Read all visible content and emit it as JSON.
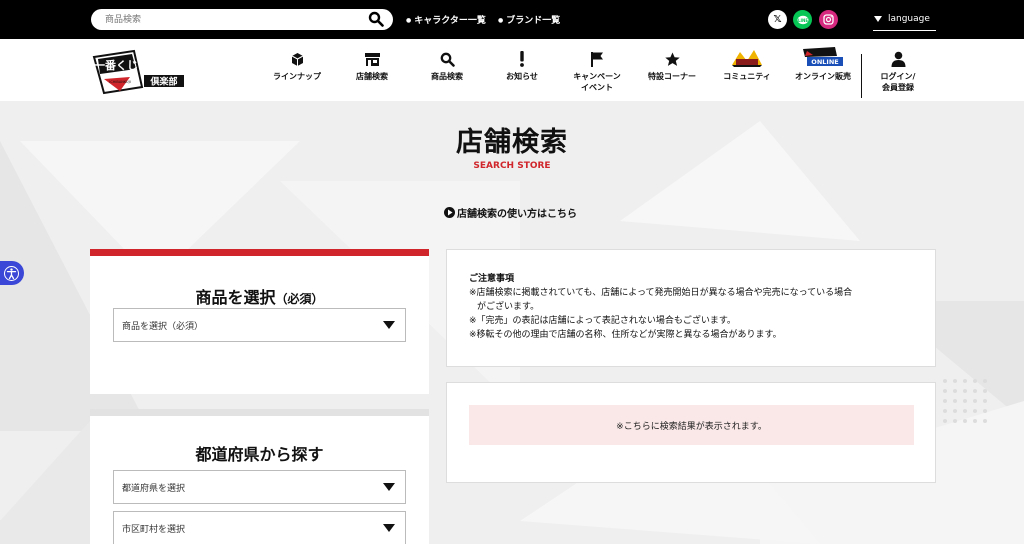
{
  "topbar": {
    "search": {
      "placeholder": "商品検索",
      "value": ""
    },
    "links": [
      "キャラクター一覧",
      "ブランド一覧"
    ],
    "social": [
      "x-icon",
      "line-icon",
      "instagram-icon"
    ],
    "language_label": "language"
  },
  "nav": {
    "logo_icon": "ichiban-kuji-club-logo",
    "items": [
      {
        "label": "ラインナップ",
        "icon": "box-icon"
      },
      {
        "label": "店舗検索",
        "icon": "store-icon"
      },
      {
        "label": "商品検索",
        "icon": "search-icon"
      },
      {
        "label": "お知らせ",
        "icon": "exclamation-icon"
      },
      {
        "label": "キャンペーン\nイベント",
        "icon": "flag-icon"
      },
      {
        "label": "特設コーナー",
        "icon": "star-icon"
      },
      {
        "label": "コミュニティ",
        "icon": "community-logo-icon"
      },
      {
        "label": "オンライン販売",
        "icon": "online-logo-icon"
      },
      {
        "label": "ログイン/\n会員登録",
        "icon": "user-icon"
      }
    ]
  },
  "page": {
    "title": "店舗検索",
    "subtitle": "SEARCH STORE",
    "howto_link": "店舗検索の使い方はこちら"
  },
  "product_panel": {
    "title": "商品を選択",
    "title_note": "（必須）",
    "select_value": "商品を選択（必須）"
  },
  "area_panel": {
    "title": "都道府県から探す",
    "prefecture_select": "都道府県を選択",
    "city_select": "市区町村を選択"
  },
  "notice": {
    "title": "ご注意事項",
    "lines": [
      "※店舗検索に掲載されていても、店舗によって発売開始日が異なる場合や完売になっている場合",
      "がございます。",
      "※「完売」の表記は店舗によって表記されない場合もございます。",
      "※移転その他の理由で店舗の名称、住所などが実際と異なる場合があります。"
    ]
  },
  "results": {
    "message": "※こちらに検索結果が表示されます。"
  },
  "colors": {
    "accent": "#d0262b",
    "topbar": "#000000",
    "result_bg": "#fae8e8",
    "line_green": "#06c755",
    "instagram": "#d6287e",
    "a11y": "#3b47d6"
  }
}
